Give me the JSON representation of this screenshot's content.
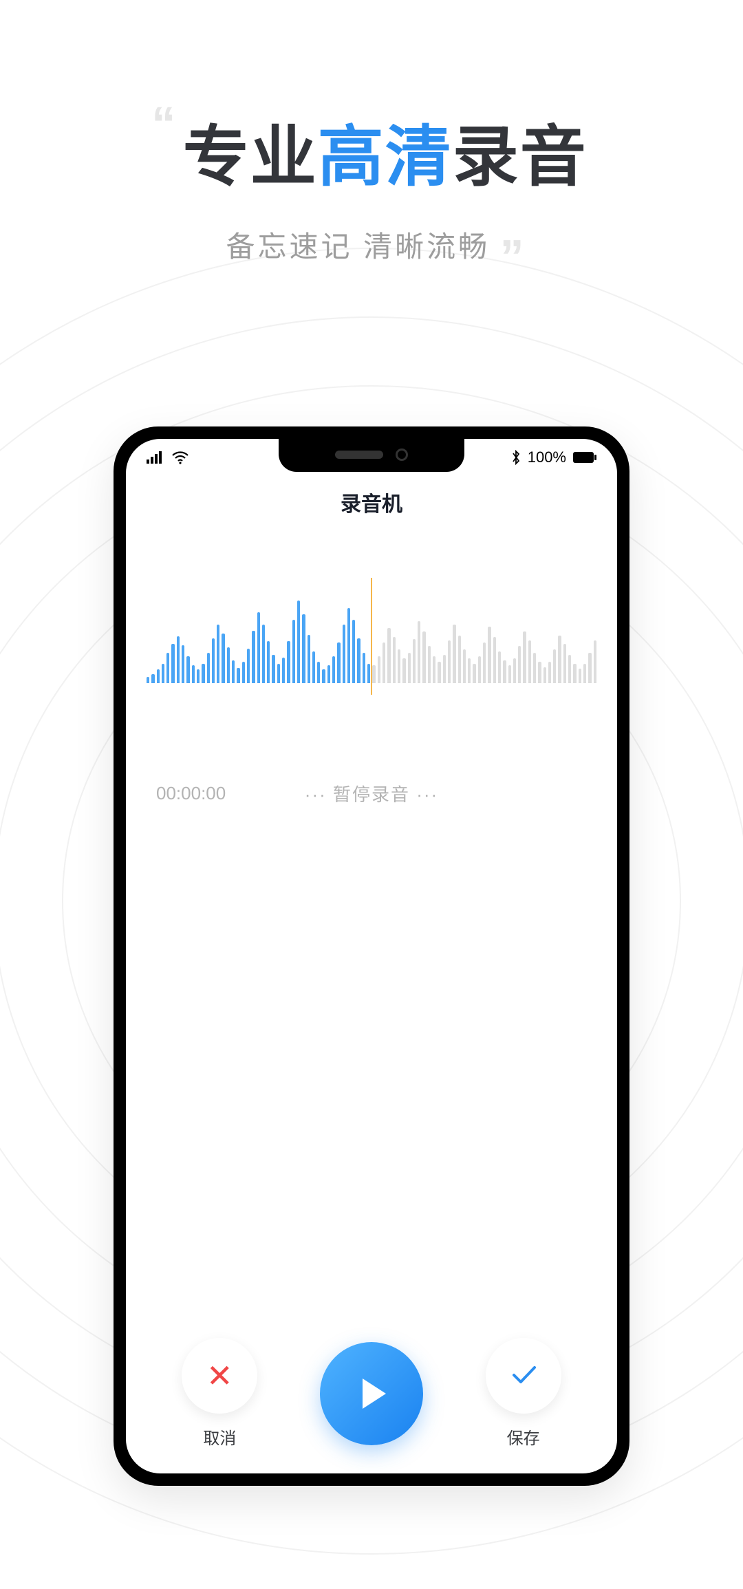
{
  "headline": {
    "part1": "专业",
    "accent": "高清",
    "part3": "录音",
    "quote_open": "“",
    "quote_close": "”"
  },
  "subtitle": "备忘速记 清晰流畅",
  "status_bar": {
    "battery": "100%"
  },
  "app": {
    "title": "录音机"
  },
  "recording": {
    "time": "00:00:00",
    "status_text": "··· 暂停录音 ···"
  },
  "actions": {
    "cancel": "取消",
    "save": "保存"
  },
  "colors": {
    "accent_blue": "#2b8ef0",
    "cancel_red": "#f04646",
    "waveform_active": "#4aa5f5",
    "waveform_inactive": "#dddddd",
    "playhead": "#f5b74b"
  },
  "waveform": {
    "left_bars": [
      8,
      12,
      18,
      26,
      40,
      52,
      62,
      50,
      36,
      24,
      18,
      26,
      40,
      60,
      78,
      66,
      48,
      30,
      20,
      28,
      46,
      70,
      94,
      78,
      56,
      38,
      26,
      34,
      56,
      84,
      110,
      92,
      64,
      42,
      28,
      18,
      24,
      36,
      54,
      78,
      100,
      84,
      60,
      40,
      26
    ],
    "right_bars": [
      20,
      30,
      46,
      62,
      52,
      38,
      28,
      34,
      50,
      70,
      58,
      42,
      30,
      24,
      32,
      48,
      66,
      54,
      38,
      28,
      22,
      30,
      46,
      64,
      52,
      36,
      26,
      20,
      28,
      42,
      58,
      48,
      34,
      24,
      18,
      24,
      38,
      54,
      44,
      32,
      22,
      16,
      22,
      34,
      48
    ]
  }
}
